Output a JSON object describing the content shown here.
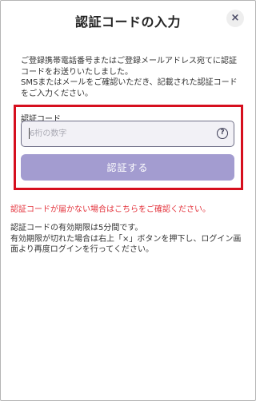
{
  "header": {
    "title": "認証コードの入力",
    "close_label": "×"
  },
  "description": {
    "line1": "ご登録携帯電話番号またはご登録メールアドレス宛てに認証コードをお送りいたしました。",
    "line2": "SMSまたはメールをご確認いただき、記載された認証コードをご入力ください。"
  },
  "form": {
    "field_label": "認証コード",
    "input_value": "",
    "input_placeholder": "6桁の数字",
    "help_icon": "question-circle-icon",
    "submit_label": "認証する"
  },
  "notice": {
    "prefix": "認証コードが届かない場合は",
    "link": "こちら",
    "suffix": "をご確認ください。"
  },
  "expiry": {
    "line1": "認証コードの有効期限は5分間です。",
    "line2": "有効期限が切れた場合は右上「×」ボタンを押下し、ログイン画面より再度ログインを行ってください。"
  },
  "colors": {
    "highlight_border": "#d60f1e",
    "button_bg": "#a39cd0",
    "input_bg": "#f2f1f6",
    "notice_text": "#e3323b"
  }
}
